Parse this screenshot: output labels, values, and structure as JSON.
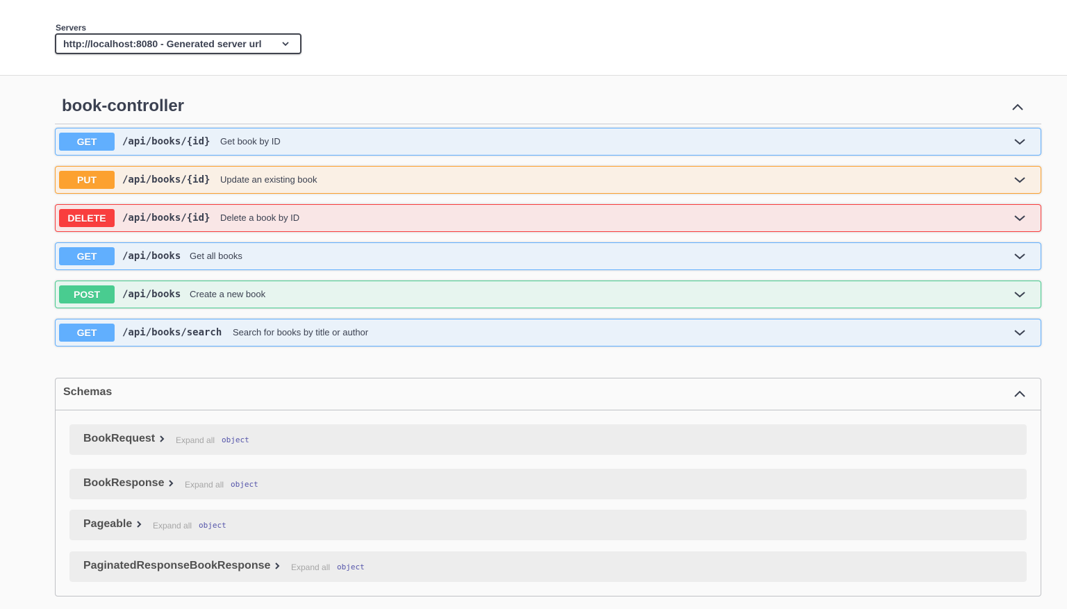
{
  "servers": {
    "label": "Servers",
    "selected": "http://localhost:8080 - Generated server url"
  },
  "tag": {
    "name": "book-controller"
  },
  "operations": [
    {
      "method": "GET",
      "path": "/api/books/{id}",
      "summary": "Get book by ID"
    },
    {
      "method": "PUT",
      "path": "/api/books/{id}",
      "summary": "Update an existing book"
    },
    {
      "method": "DELETE",
      "path": "/api/books/{id}",
      "summary": "Delete a book by ID"
    },
    {
      "method": "GET",
      "path": "/api/books",
      "summary": "Get all books"
    },
    {
      "method": "POST",
      "path": "/api/books",
      "summary": "Create a new book"
    },
    {
      "method": "GET",
      "path": "/api/books/search",
      "summary": "Search for books by title or author"
    }
  ],
  "schemas": {
    "title": "Schemas",
    "models": [
      {
        "name": "BookRequest",
        "expand": "Expand all",
        "type": "object"
      },
      {
        "name": "BookResponse",
        "expand": "Expand all",
        "type": "object"
      },
      {
        "name": "Pageable",
        "expand": "Expand all",
        "type": "object"
      },
      {
        "name": "PaginatedResponseBookResponse",
        "expand": "Expand all",
        "type": "object"
      }
    ]
  },
  "colors": {
    "get": "#61affe",
    "put": "#fca130",
    "delete": "#f93e3e",
    "post": "#49cc90"
  },
  "icons": {
    "server_dropdown": "chevron-down-icon",
    "tag_toggle": "chevron-up-icon",
    "operation_toggle": "chevron-down-icon",
    "schemas_toggle": "chevron-up-icon",
    "model_expand": "chevron-right-icon"
  }
}
